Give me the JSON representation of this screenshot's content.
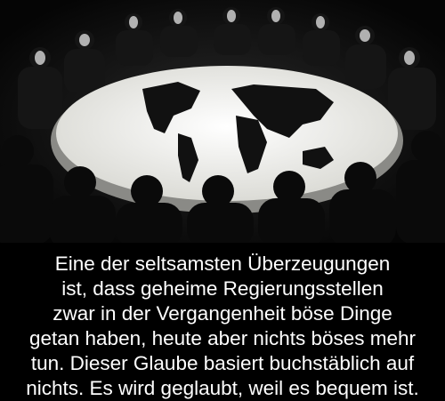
{
  "caption": {
    "lines": [
      "Eine der seltsamsten Überzeugungen",
      "ist, dass geheime Regierungsstellen",
      "zwar in der Vergangenheit böse Dinge",
      "getan haben, heute aber nichts böses mehr",
      "tun. Dieser Glaube basiert buchstäblich auf",
      "nichts. Es wird geglaubt, weil es bequem ist."
    ]
  },
  "colors": {
    "background": "#000000",
    "text": "#ffffff",
    "table": "#f2f2ee"
  }
}
